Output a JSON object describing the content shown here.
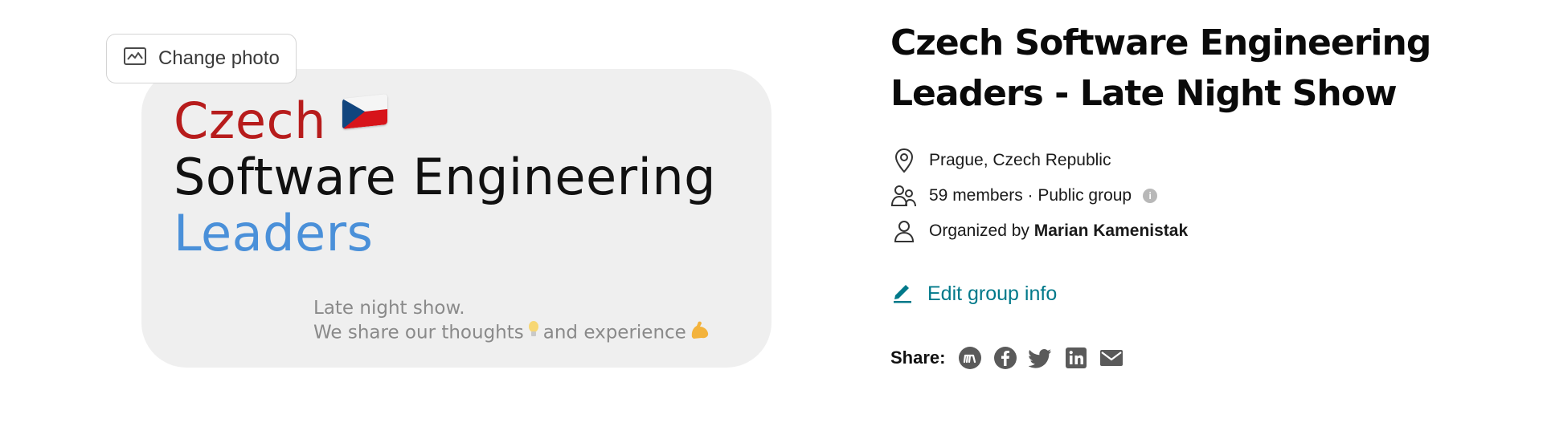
{
  "cover": {
    "change_photo_label": "Change photo",
    "title_line1": "Czech",
    "title_line2": "Software Engineering",
    "title_line3": "Leaders",
    "tagline_line1": "Late night show.",
    "tagline_line2_prefix": "We share our thoughts",
    "tagline_line2_middle": "and experience",
    "colors": {
      "czech": "#b71c1c",
      "leaders": "#4a90d9",
      "background": "#efefef"
    }
  },
  "group": {
    "title": "Czech Software Engineering Leaders - Late Night Show",
    "location": "Prague, Czech Republic",
    "members": "59 members · Public group",
    "organized_by_prefix": "Organized by",
    "organizer": "Marian Kamenistak",
    "edit_label": "Edit group info"
  },
  "share": {
    "label": "Share:",
    "icons": [
      "meetup-icon",
      "facebook-icon",
      "twitter-icon",
      "linkedin-icon",
      "email-icon"
    ]
  },
  "accent_color": "#00798a"
}
